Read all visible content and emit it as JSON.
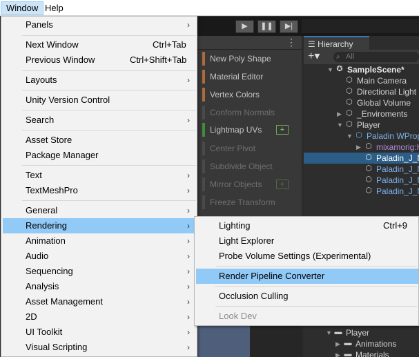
{
  "menubar": {
    "window": "Window",
    "help": "Help"
  },
  "toolbar": {
    "play": "▶",
    "pause": "❚❚",
    "step": "▶|"
  },
  "polybrush": {
    "menu_dots": "⋮",
    "items": [
      {
        "label": "New Poly Shape",
        "enabled": true
      },
      {
        "label": "Material Editor",
        "enabled": true
      },
      {
        "label": "Vertex Colors",
        "enabled": true
      },
      {
        "label": "Conform Normals",
        "enabled": false
      },
      {
        "label": "Lightmap UVs",
        "enabled": true,
        "plus": "+"
      },
      {
        "label": "Center Pivot",
        "enabled": false
      },
      {
        "label": "Subdivide Object",
        "enabled": false
      },
      {
        "label": "Mirror Objects",
        "enabled": false,
        "plus": "+"
      },
      {
        "label": "Freeze Transform",
        "enabled": false
      }
    ]
  },
  "hierarchy": {
    "tab": "Hierarchy",
    "add": "+▾",
    "search_placeholder": "All",
    "rows": [
      {
        "label": "SampleScene*",
        "style": "bold"
      },
      {
        "label": "Main Camera"
      },
      {
        "label": "Directional Light"
      },
      {
        "label": "Global Volume"
      },
      {
        "label": "_Enviroments"
      },
      {
        "label": "Player"
      },
      {
        "label": "Paladin WProp"
      },
      {
        "label": "mixamorig:Hips"
      },
      {
        "label": "Paladin_J_Nordstrom"
      },
      {
        "label": "Paladin_J_Nordstrom"
      },
      {
        "label": "Paladin_J_Nordstrom"
      },
      {
        "label": "Paladin_J_Nordstrom"
      }
    ]
  },
  "project": {
    "rows": [
      {
        "label": "Player"
      },
      {
        "label": "Animations"
      },
      {
        "label": "Materials"
      }
    ]
  },
  "window_menu": {
    "items": [
      {
        "label": "Panels",
        "submenu": true
      },
      {
        "label": "Next Window",
        "shortcut": "Ctrl+Tab"
      },
      {
        "label": "Previous Window",
        "shortcut": "Ctrl+Shift+Tab"
      },
      {
        "label": "Layouts",
        "submenu": true
      },
      {
        "label": "Unity Version Control"
      },
      {
        "label": "Search",
        "submenu": true
      },
      {
        "label": "Asset Store"
      },
      {
        "label": "Package Manager"
      },
      {
        "label": "Text",
        "submenu": true
      },
      {
        "label": "TextMeshPro",
        "submenu": true
      },
      {
        "label": "General",
        "submenu": true
      },
      {
        "label": "Rendering",
        "submenu": true,
        "active": true
      },
      {
        "label": "Animation",
        "submenu": true
      },
      {
        "label": "Audio",
        "submenu": true
      },
      {
        "label": "Sequencing",
        "submenu": true
      },
      {
        "label": "Analysis",
        "submenu": true
      },
      {
        "label": "Asset Management",
        "submenu": true
      },
      {
        "label": "2D",
        "submenu": true
      },
      {
        "label": "UI Toolkit",
        "submenu": true
      },
      {
        "label": "Visual Scripting",
        "submenu": true
      }
    ]
  },
  "rendering_menu": {
    "items": [
      {
        "label": "Lighting",
        "shortcut": "Ctrl+9"
      },
      {
        "label": "Light Explorer"
      },
      {
        "label": "Probe Volume Settings (Experimental)"
      },
      {
        "label": "Render Pipeline Converter",
        "active": true
      },
      {
        "label": "Occlusion Culling"
      },
      {
        "label": "Look Dev",
        "disabled": true
      }
    ]
  }
}
